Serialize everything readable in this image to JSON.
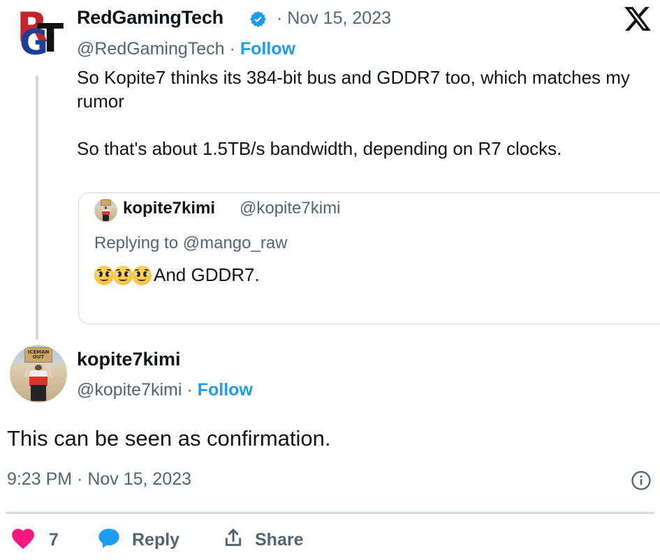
{
  "platform": {
    "name": "X",
    "logo_icon": "x-logo-icon",
    "colors": {
      "text_primary": "#0f1419",
      "text_secondary": "#536471",
      "link_blue": "#1d9bf0",
      "like_pink": "#f91880",
      "border": "#cfd9de",
      "background": "#ffffff"
    }
  },
  "tweet_primary": {
    "author": {
      "display_name": "RedGamingTech",
      "handle": "@RedGamingTech",
      "verified": true,
      "verified_icon": "verified-badge-icon",
      "avatar_alt": "RedGamingTech RGT logo",
      "avatar_letters": {
        "r": "R",
        "g": "G",
        "t": "T"
      }
    },
    "separator": "·",
    "date": "Nov 15, 2023",
    "follow_label": "Follow",
    "body": "So Kopite7 thinks its 384-bit bus and GDDR7 too, which matches my rumor\n\nSo that's about 1.5TB/s bandwidth, depending on R7 clocks."
  },
  "quoted_tweet": {
    "author": {
      "display_name": "kopite7kimi",
      "handle": "@kopite7kimi",
      "avatar_alt": "kopite7kimi ICEMAN OUT sign avatar",
      "avatar_sign_line1": "ICEMAN",
      "avatar_sign_line2": "OUT"
    },
    "replying_to_label": "Replying to",
    "replying_to_handle": "@mango_raw",
    "emoji_names": [
      "face-holding-back-tears",
      "face-holding-back-tears",
      "face-holding-back-tears"
    ],
    "emoji_glyphs": "🥹🥹🥹",
    "text": "And GDDR7."
  },
  "tweet_reply": {
    "author": {
      "display_name": "kopite7kimi",
      "handle": "@kopite7kimi",
      "avatar_alt": "kopite7kimi ICEMAN OUT sign avatar",
      "avatar_sign_line1": "ICEMAN",
      "avatar_sign_line2": "OUT"
    },
    "separator": "·",
    "follow_label": "Follow",
    "body": "This can be seen as confirmation.",
    "timestamp": "9:23 PM · Nov 15, 2023",
    "info_icon": "info-circle-icon"
  },
  "actions": {
    "like": {
      "icon": "heart-icon",
      "count": "7"
    },
    "reply": {
      "icon": "comment-bubble-icon",
      "label": "Reply"
    },
    "share": {
      "icon": "share-upload-icon",
      "label": "Share"
    }
  }
}
